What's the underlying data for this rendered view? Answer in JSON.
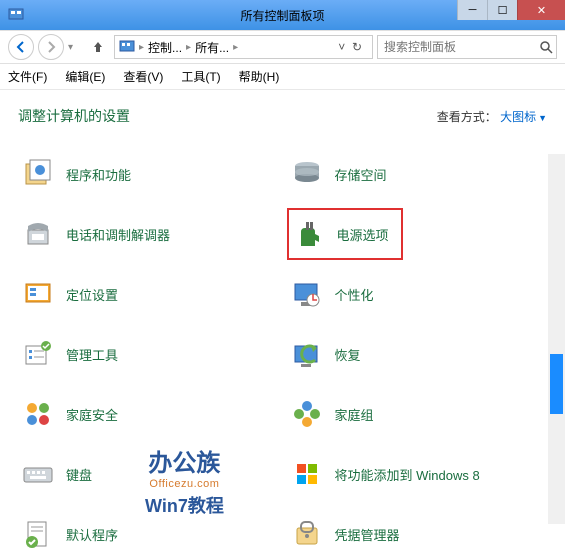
{
  "titlebar": {
    "title": "所有控制面板项"
  },
  "nav": {
    "breadcrumb": [
      "控制...",
      "所有..."
    ],
    "search_placeholder": "搜索控制面板"
  },
  "menubar": {
    "file": "文件(F)",
    "edit": "编辑(E)",
    "view": "查看(V)",
    "tools": "工具(T)",
    "help": "帮助(H)"
  },
  "header": {
    "title": "调整计算机的设置",
    "view_label": "查看方式：",
    "view_value": "大图标"
  },
  "items": [
    {
      "name": "programs-and-features",
      "label": "程序和功能"
    },
    {
      "name": "storage-spaces",
      "label": "存储空间"
    },
    {
      "name": "phone-and-modem",
      "label": "电话和调制解调器"
    },
    {
      "name": "power-options",
      "label": "电源选项",
      "highlighted": true
    },
    {
      "name": "location-settings",
      "label": "定位设置"
    },
    {
      "name": "personalization",
      "label": "个性化"
    },
    {
      "name": "administrative-tools",
      "label": "管理工具"
    },
    {
      "name": "recovery",
      "label": "恢复"
    },
    {
      "name": "family-safety",
      "label": "家庭安全"
    },
    {
      "name": "homegroup",
      "label": "家庭组"
    },
    {
      "name": "keyboard",
      "label": "键盘"
    },
    {
      "name": "add-features-windows8",
      "label": "将功能添加到 Windows 8"
    },
    {
      "name": "default-programs",
      "label": "默认程序"
    },
    {
      "name": "credential-manager",
      "label": "凭据管理器"
    }
  ],
  "watermark": {
    "brand": "办公族",
    "url": "Officezu.com",
    "sub": "Win7教程"
  }
}
